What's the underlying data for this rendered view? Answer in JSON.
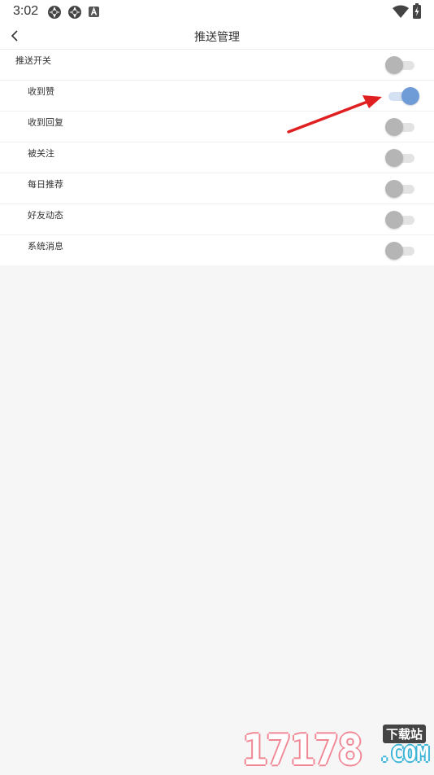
{
  "status_bar": {
    "time": "3:02",
    "icons": [
      "aperture-icon",
      "aperture-icon",
      "keyboard-a-icon",
      "wifi-icon",
      "battery-charging-icon"
    ]
  },
  "header": {
    "title": "推送管理",
    "back_icon": "chevron-left-icon"
  },
  "settings": {
    "master": {
      "label": "推送开关",
      "on": false
    },
    "items": [
      {
        "label": "收到赞",
        "on": true
      },
      {
        "label": "收到回复",
        "on": false
      },
      {
        "label": "被关注",
        "on": false
      },
      {
        "label": "每日推荐",
        "on": false
      },
      {
        "label": "好友动态",
        "on": false
      },
      {
        "label": "系统消息",
        "on": false
      }
    ]
  },
  "annotation": {
    "arrow_color": "#e02020"
  },
  "colors": {
    "toggle_on_thumb": "#6f9bd7",
    "toggle_off_thumb": "#b5b5b5",
    "background": "#f6f6f6"
  },
  "watermark": {
    "digits": "17178",
    "text": "下载站",
    "suffix": ".COM"
  }
}
